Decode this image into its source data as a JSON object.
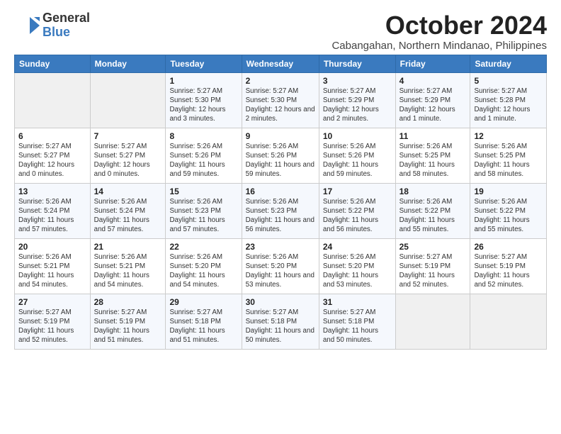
{
  "logo": {
    "general": "General",
    "blue": "Blue"
  },
  "title": "October 2024",
  "location": "Cabangahan, Northern Mindanao, Philippines",
  "days_of_week": [
    "Sunday",
    "Monday",
    "Tuesday",
    "Wednesday",
    "Thursday",
    "Friday",
    "Saturday"
  ],
  "weeks": [
    [
      {
        "day": "",
        "sunrise": "",
        "sunset": "",
        "daylight": ""
      },
      {
        "day": "",
        "sunrise": "",
        "sunset": "",
        "daylight": ""
      },
      {
        "day": "1",
        "sunrise": "Sunrise: 5:27 AM",
        "sunset": "Sunset: 5:30 PM",
        "daylight": "Daylight: 12 hours and 3 minutes."
      },
      {
        "day": "2",
        "sunrise": "Sunrise: 5:27 AM",
        "sunset": "Sunset: 5:30 PM",
        "daylight": "Daylight: 12 hours and 2 minutes."
      },
      {
        "day": "3",
        "sunrise": "Sunrise: 5:27 AM",
        "sunset": "Sunset: 5:29 PM",
        "daylight": "Daylight: 12 hours and 2 minutes."
      },
      {
        "day": "4",
        "sunrise": "Sunrise: 5:27 AM",
        "sunset": "Sunset: 5:29 PM",
        "daylight": "Daylight: 12 hours and 1 minute."
      },
      {
        "day": "5",
        "sunrise": "Sunrise: 5:27 AM",
        "sunset": "Sunset: 5:28 PM",
        "daylight": "Daylight: 12 hours and 1 minute."
      }
    ],
    [
      {
        "day": "6",
        "sunrise": "Sunrise: 5:27 AM",
        "sunset": "Sunset: 5:27 PM",
        "daylight": "Daylight: 12 hours and 0 minutes."
      },
      {
        "day": "7",
        "sunrise": "Sunrise: 5:27 AM",
        "sunset": "Sunset: 5:27 PM",
        "daylight": "Daylight: 12 hours and 0 minutes."
      },
      {
        "day": "8",
        "sunrise": "Sunrise: 5:26 AM",
        "sunset": "Sunset: 5:26 PM",
        "daylight": "Daylight: 11 hours and 59 minutes."
      },
      {
        "day": "9",
        "sunrise": "Sunrise: 5:26 AM",
        "sunset": "Sunset: 5:26 PM",
        "daylight": "Daylight: 11 hours and 59 minutes."
      },
      {
        "day": "10",
        "sunrise": "Sunrise: 5:26 AM",
        "sunset": "Sunset: 5:26 PM",
        "daylight": "Daylight: 11 hours and 59 minutes."
      },
      {
        "day": "11",
        "sunrise": "Sunrise: 5:26 AM",
        "sunset": "Sunset: 5:25 PM",
        "daylight": "Daylight: 11 hours and 58 minutes."
      },
      {
        "day": "12",
        "sunrise": "Sunrise: 5:26 AM",
        "sunset": "Sunset: 5:25 PM",
        "daylight": "Daylight: 11 hours and 58 minutes."
      }
    ],
    [
      {
        "day": "13",
        "sunrise": "Sunrise: 5:26 AM",
        "sunset": "Sunset: 5:24 PM",
        "daylight": "Daylight: 11 hours and 57 minutes."
      },
      {
        "day": "14",
        "sunrise": "Sunrise: 5:26 AM",
        "sunset": "Sunset: 5:24 PM",
        "daylight": "Daylight: 11 hours and 57 minutes."
      },
      {
        "day": "15",
        "sunrise": "Sunrise: 5:26 AM",
        "sunset": "Sunset: 5:23 PM",
        "daylight": "Daylight: 11 hours and 57 minutes."
      },
      {
        "day": "16",
        "sunrise": "Sunrise: 5:26 AM",
        "sunset": "Sunset: 5:23 PM",
        "daylight": "Daylight: 11 hours and 56 minutes."
      },
      {
        "day": "17",
        "sunrise": "Sunrise: 5:26 AM",
        "sunset": "Sunset: 5:22 PM",
        "daylight": "Daylight: 11 hours and 56 minutes."
      },
      {
        "day": "18",
        "sunrise": "Sunrise: 5:26 AM",
        "sunset": "Sunset: 5:22 PM",
        "daylight": "Daylight: 11 hours and 55 minutes."
      },
      {
        "day": "19",
        "sunrise": "Sunrise: 5:26 AM",
        "sunset": "Sunset: 5:22 PM",
        "daylight": "Daylight: 11 hours and 55 minutes."
      }
    ],
    [
      {
        "day": "20",
        "sunrise": "Sunrise: 5:26 AM",
        "sunset": "Sunset: 5:21 PM",
        "daylight": "Daylight: 11 hours and 54 minutes."
      },
      {
        "day": "21",
        "sunrise": "Sunrise: 5:26 AM",
        "sunset": "Sunset: 5:21 PM",
        "daylight": "Daylight: 11 hours and 54 minutes."
      },
      {
        "day": "22",
        "sunrise": "Sunrise: 5:26 AM",
        "sunset": "Sunset: 5:20 PM",
        "daylight": "Daylight: 11 hours and 54 minutes."
      },
      {
        "day": "23",
        "sunrise": "Sunrise: 5:26 AM",
        "sunset": "Sunset: 5:20 PM",
        "daylight": "Daylight: 11 hours and 53 minutes."
      },
      {
        "day": "24",
        "sunrise": "Sunrise: 5:26 AM",
        "sunset": "Sunset: 5:20 PM",
        "daylight": "Daylight: 11 hours and 53 minutes."
      },
      {
        "day": "25",
        "sunrise": "Sunrise: 5:27 AM",
        "sunset": "Sunset: 5:19 PM",
        "daylight": "Daylight: 11 hours and 52 minutes."
      },
      {
        "day": "26",
        "sunrise": "Sunrise: 5:27 AM",
        "sunset": "Sunset: 5:19 PM",
        "daylight": "Daylight: 11 hours and 52 minutes."
      }
    ],
    [
      {
        "day": "27",
        "sunrise": "Sunrise: 5:27 AM",
        "sunset": "Sunset: 5:19 PM",
        "daylight": "Daylight: 11 hours and 52 minutes."
      },
      {
        "day": "28",
        "sunrise": "Sunrise: 5:27 AM",
        "sunset": "Sunset: 5:19 PM",
        "daylight": "Daylight: 11 hours and 51 minutes."
      },
      {
        "day": "29",
        "sunrise": "Sunrise: 5:27 AM",
        "sunset": "Sunset: 5:18 PM",
        "daylight": "Daylight: 11 hours and 51 minutes."
      },
      {
        "day": "30",
        "sunrise": "Sunrise: 5:27 AM",
        "sunset": "Sunset: 5:18 PM",
        "daylight": "Daylight: 11 hours and 50 minutes."
      },
      {
        "day": "31",
        "sunrise": "Sunrise: 5:27 AM",
        "sunset": "Sunset: 5:18 PM",
        "daylight": "Daylight: 11 hours and 50 minutes."
      },
      {
        "day": "",
        "sunrise": "",
        "sunset": "",
        "daylight": ""
      },
      {
        "day": "",
        "sunrise": "",
        "sunset": "",
        "daylight": ""
      }
    ]
  ]
}
